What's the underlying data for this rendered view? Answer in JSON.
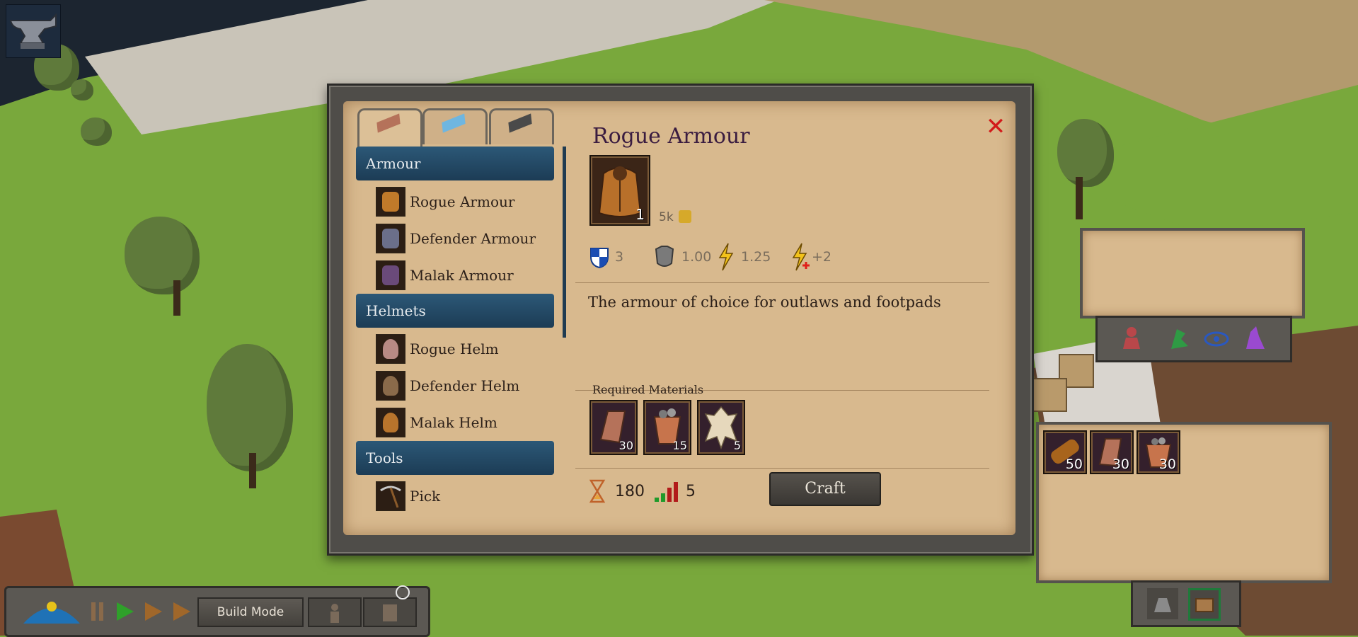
{
  "window": {
    "tabs": [
      {
        "name": "copper-ingot-tab",
        "color": "#b5725a"
      },
      {
        "name": "blue-ingot-tab",
        "color": "#6fb6e0"
      },
      {
        "name": "iron-ingot-tab",
        "color": "#4a4a4a"
      }
    ],
    "close_label": "✕",
    "categories": [
      {
        "label": "Armour",
        "items": [
          {
            "label": "Rogue Armour",
            "icon": "rogue-armour-icon"
          },
          {
            "label": "Defender Armour",
            "icon": "defender-armour-icon"
          },
          {
            "label": "Malak Armour",
            "icon": "malak-armour-icon"
          }
        ]
      },
      {
        "label": "Helmets",
        "items": [
          {
            "label": "Rogue Helm",
            "icon": "rogue-helm-icon"
          },
          {
            "label": "Defender Helm",
            "icon": "defender-helm-icon"
          },
          {
            "label": "Malak Helm",
            "icon": "malak-helm-icon"
          }
        ]
      },
      {
        "label": "Tools",
        "items": [
          {
            "label": "Pick",
            "icon": "pick-icon"
          }
        ]
      }
    ]
  },
  "detail": {
    "title": "Rogue Armour",
    "quantity": "1",
    "value": "5k",
    "stats": {
      "defense": "3",
      "weight": "1.00",
      "energy": "1.25",
      "energy_bonus": "+2"
    },
    "description": "The armour of choice for outlaws and footpads",
    "required_label": "Required Materials",
    "materials": [
      {
        "name": "copper-ingot",
        "qty": "30"
      },
      {
        "name": "ore-bucket",
        "qty": "15"
      },
      {
        "name": "leather-hide",
        "qty": "5"
      }
    ],
    "craft_time": "180",
    "craft_level": "5",
    "craft_label": "Craft"
  },
  "inventory": {
    "slots": [
      {
        "name": "wood-log",
        "qty": "50"
      },
      {
        "name": "copper-ingot",
        "qty": "30"
      },
      {
        "name": "ore-bucket",
        "qty": "30"
      }
    ]
  },
  "toolbar": {
    "build_mode_label": "Build Mode"
  },
  "colors": {
    "header_blue": "#1f3f59",
    "parchment": "#d8b98e",
    "close_red": "#d21a1a"
  }
}
